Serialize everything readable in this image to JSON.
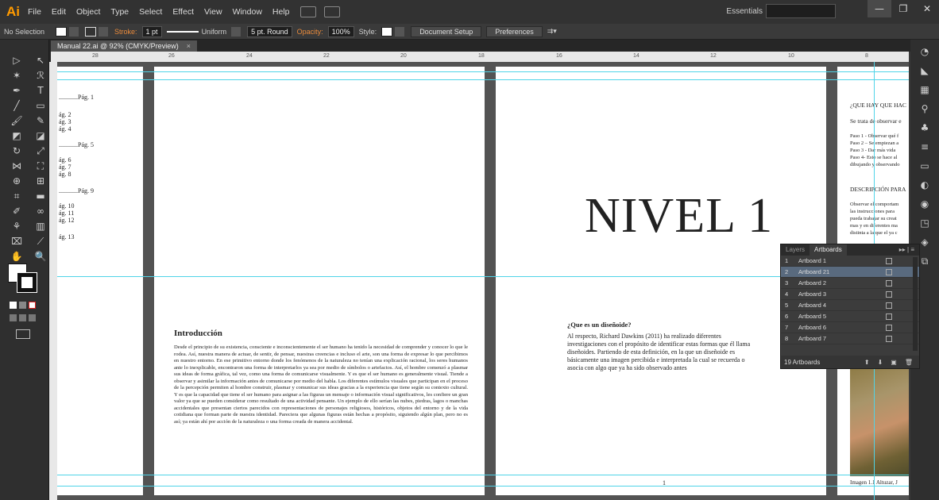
{
  "app": {
    "logo": "Ai"
  },
  "menu": [
    "File",
    "Edit",
    "Object",
    "Type",
    "Select",
    "Effect",
    "View",
    "Window",
    "Help"
  ],
  "workspace": {
    "label": "Essentials"
  },
  "window_buttons": {
    "min": "—",
    "restore": "❐",
    "close": "✕"
  },
  "control_bar": {
    "selection": "No Selection",
    "stroke_label": "Stroke:",
    "stroke_weight": "1 pt",
    "profile": "Uniform",
    "brush": "5 pt. Round",
    "opacity_label": "Opacity:",
    "opacity": "100%",
    "style_label": "Style:",
    "document_setup": "Document Setup",
    "preferences": "Preferences"
  },
  "document_tab": {
    "title": "Manual 22.ai @ 92% (CMYK/Preview)",
    "close": "×"
  },
  "ruler_marks": [
    "28",
    "26",
    "24",
    "22",
    "20",
    "18",
    "16",
    "14",
    "12",
    "10",
    "8"
  ],
  "artboard_a": {
    "toc": [
      "............Pág. 1",
      "ág. 2",
      "ág. 3",
      "ág. 4",
      "............Pág. 5",
      "ág. 6",
      "ág. 7",
      "ág. 8",
      "............Pág. 9",
      "ág. 10",
      "ág. 11",
      "ág. 12",
      "ág. 13"
    ]
  },
  "artboard_b": {
    "title": "Introducción",
    "body": "Desde el principio de su existencia, consciente e inconscientemente el ser humano ha tenido la necesidad de comprender y conocer lo que le rodea. Así, nuestra manera de actuar, de sentir, de pensar, nuestras creencias e incluso el arte, son una forma de expresar lo que percibimos en nuestro entorno. En ese primitivo entorno donde los fenómenos de la naturaleza no tenían una explicación racional, los seres humanos ante lo inexplicable, encontraron una forma de interpretarlos ya sea por medio de símbolos o artefactos. Así, el hombre comenzó a plasmar sus ideas de forma gráfica, tal vez, como una forma de comunicarse visualmente. Y es que el ser humano es generalmente visual. Tiende a observar y asimilar la información antes de comunicarse por medio del habla. Los diferentes estímulos visuales que participan en el proceso de la percepción permiten al hombre construir, plasmar y comunicar sus ideas gracias a la experiencia que tiene según su contexto cultural. Y es que la capacidad que tiene el ser humano para asignar a las figuras un mensaje o información visual significativos, les confiere un gran valor ya que se pueden considerar como resultado de una actividad pensante. Un ejemplo de ello serían las nubes, piedras, lagos o manchas accidentales que presentan ciertos parecidos con representaciones de personajes religiosos, históricos, objetos del entorno y de la vida cotidiana que forman parte de nuestra identidad. Pareciera que algunas figuras están hechas a propósito, siguiendo algún plan, pero no es así; ya están ahí por acción de la naturaleza o una forma creada de manera accidental."
  },
  "artboard_c": {
    "heading": "NIVEL 1",
    "question": "¿Que es un diseñoide?",
    "body": "Al respecto, Richard Dawkins (2011) ha realizado diferentes investigaciones con el propósito de identificar estas formas que él llama diseñoides. Partiendo de esta definición, en la que un diseñoide es básicamente una imagen percibida e interpretada la cual se recuerda o asocia con algo que ya ha sido observado antes",
    "page_number": "1"
  },
  "artboard_d": {
    "heading": "¿QUE HAY QUE HAC",
    "line1": "Se trata de observar  e",
    "steps": [
      "Paso 1 - Observar qué f",
      "Paso 2 – Se empiezan a",
      "Paso 3 -  Dar más vida",
      "Paso 4- Esto se hace al",
      "dibujando y observando"
    ],
    "desc_heading": "DESCRIPCIÓN PARA",
    "desc_lines": [
      "Observar el comportam",
      "las instrucciones  para",
      "pueda trabajar su creat",
      "mas y en diferentes ma",
      "distinta a la que el ya c"
    ],
    "caption": "Imagen 1.1  Altuzar, J"
  },
  "artboards_panel": {
    "tabs": [
      "Layers",
      "Artboards"
    ],
    "menu": "▸▸ | ≡",
    "rows": [
      {
        "num": "1",
        "name": "Artboard 1"
      },
      {
        "num": "2",
        "name": "Artboard 21"
      },
      {
        "num": "3",
        "name": "Artboard 2"
      },
      {
        "num": "4",
        "name": "Artboard 3"
      },
      {
        "num": "5",
        "name": "Artboard 4"
      },
      {
        "num": "6",
        "name": "Artboard 5"
      },
      {
        "num": "7",
        "name": "Artboard 6"
      },
      {
        "num": "8",
        "name": "Artboard 7"
      }
    ],
    "selected_index": 1,
    "footer": "19 Artboards"
  },
  "colors": {
    "accent": "#ff9a00",
    "selection": "#596a7e",
    "guide": "#4fd4e8"
  }
}
